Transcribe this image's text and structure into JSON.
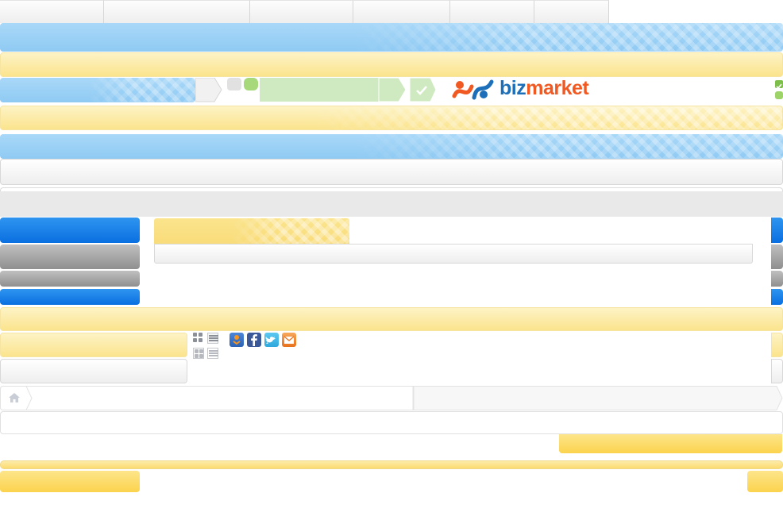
{
  "logo": {
    "text_biz": "biz",
    "text_market": "market"
  },
  "colors": {
    "brand_blue": "#1c6fb8",
    "brand_orange": "#f05a22",
    "accent_blue": "#0a6fe0",
    "accent_yellow": "#fbe48d",
    "accent_green": "#9ed36a"
  },
  "share": {
    "icons": [
      "odnoklassniki-icon",
      "facebook-icon",
      "twitter-icon",
      "email-icon"
    ]
  },
  "breadcrumb": {
    "home_icon": "home-icon"
  },
  "view_toggles": [
    "grid-view-icon",
    "list-view-icon"
  ]
}
